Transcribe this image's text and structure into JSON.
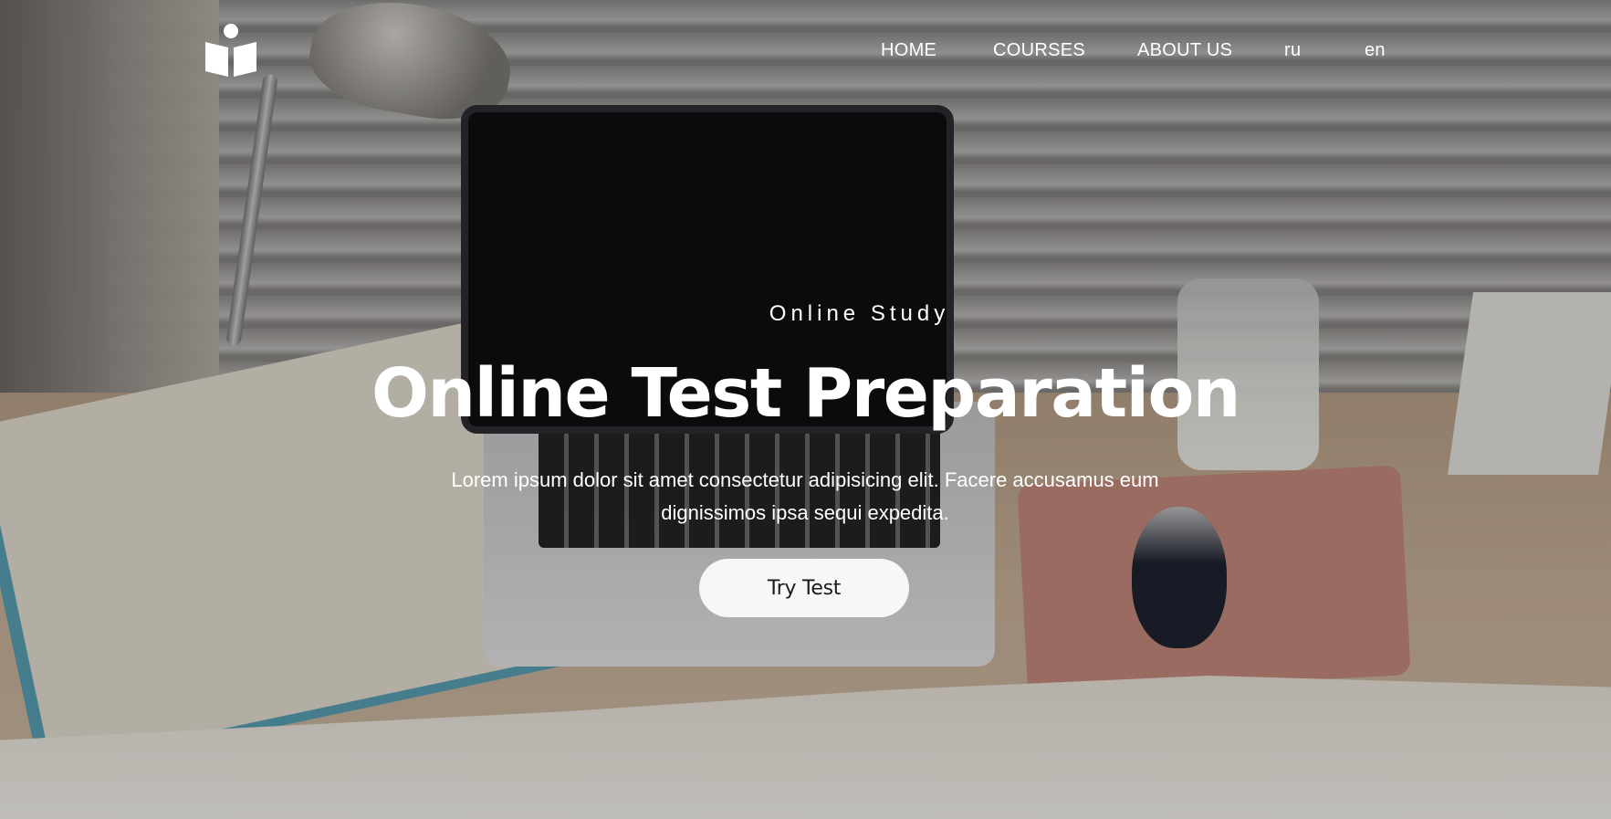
{
  "brand": {
    "logo_icon": "open-book-reader-icon",
    "accent_color": "#ffffff"
  },
  "nav": {
    "items": [
      {
        "label": "HOME"
      },
      {
        "label": "COURSES"
      },
      {
        "label": "ABOUT US"
      },
      {
        "label": "ru"
      },
      {
        "label": "en"
      }
    ]
  },
  "hero": {
    "eyebrow": "Online Study",
    "title": "Online Test Preparation",
    "lead": "Lorem ipsum dolor sit amet consectetur adipisicing elit. Facere accusamus eum dignissimos ipsa sequi expedita.",
    "cta_label": "Try Test",
    "cta_bg": "#f7f7f7"
  }
}
